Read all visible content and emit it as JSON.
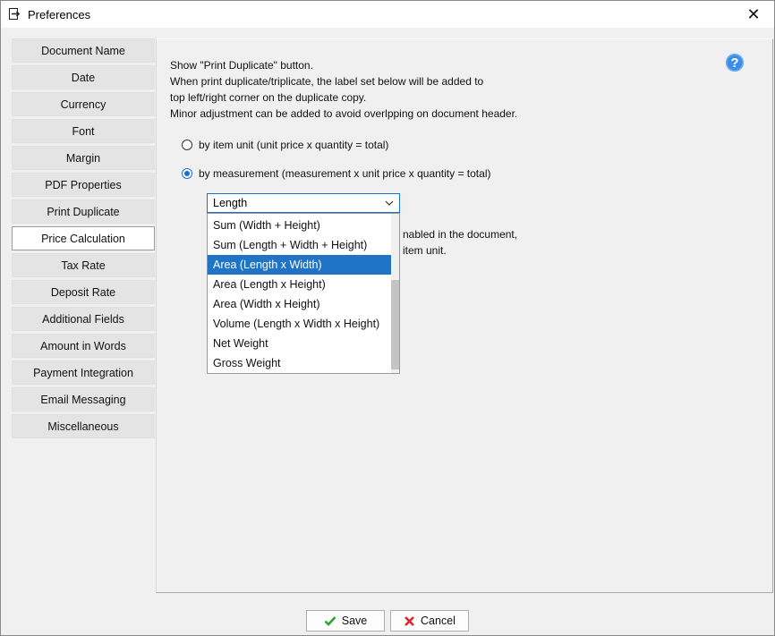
{
  "window": {
    "title": "Preferences",
    "app_icon": "exit-door-icon",
    "close_glyph": "✕"
  },
  "sidebar": {
    "items": [
      {
        "label": "Document Name"
      },
      {
        "label": "Date"
      },
      {
        "label": "Currency"
      },
      {
        "label": "Font"
      },
      {
        "label": "Margin"
      },
      {
        "label": "PDF Properties"
      },
      {
        "label": "Print Duplicate"
      },
      {
        "label": "Price Calculation",
        "active": true
      },
      {
        "label": "Tax Rate"
      },
      {
        "label": "Deposit Rate"
      },
      {
        "label": "Additional Fields"
      },
      {
        "label": "Amount in Words"
      },
      {
        "label": "Payment Integration"
      },
      {
        "label": "Email Messaging"
      },
      {
        "label": "Miscellaneous"
      }
    ]
  },
  "content": {
    "description": [
      "Show \"Print Duplicate\" button.",
      "When print duplicate/triplicate, the label set below will be added to",
      "top left/right corner on the duplicate copy.",
      "Minor adjustment can be added to avoid overlpping on document header."
    ],
    "help_glyph": "?",
    "radio_item_unit": "by item unit (unit price x quantity = total)",
    "radio_measurement": "by measurement (measurement x unit price x quantity = total)",
    "selected_radio": "measurement",
    "select_value": "Length",
    "behind_text_1": "nabled in the document,",
    "behind_text_2": "item unit.",
    "dropdown_options": [
      "Sum (Width + Height)",
      "Sum (Length + Width + Height)",
      "Area (Length x Width)",
      "Area (Length x Height)",
      "Area (Width x Height)",
      "Volume (Length x Width x Height)",
      "Net Weight",
      "Gross Weight"
    ],
    "highlighted_option": "Area (Length x Width)"
  },
  "footer": {
    "save_label": "Save",
    "cancel_label": "Cancel",
    "save_icon": "check-icon",
    "cancel_icon": "x-icon"
  },
  "colors": {
    "accent": "#1f74c7",
    "help": "#3a8ee6",
    "save_check": "#2aa52a",
    "cancel_x": "#d9252b"
  }
}
